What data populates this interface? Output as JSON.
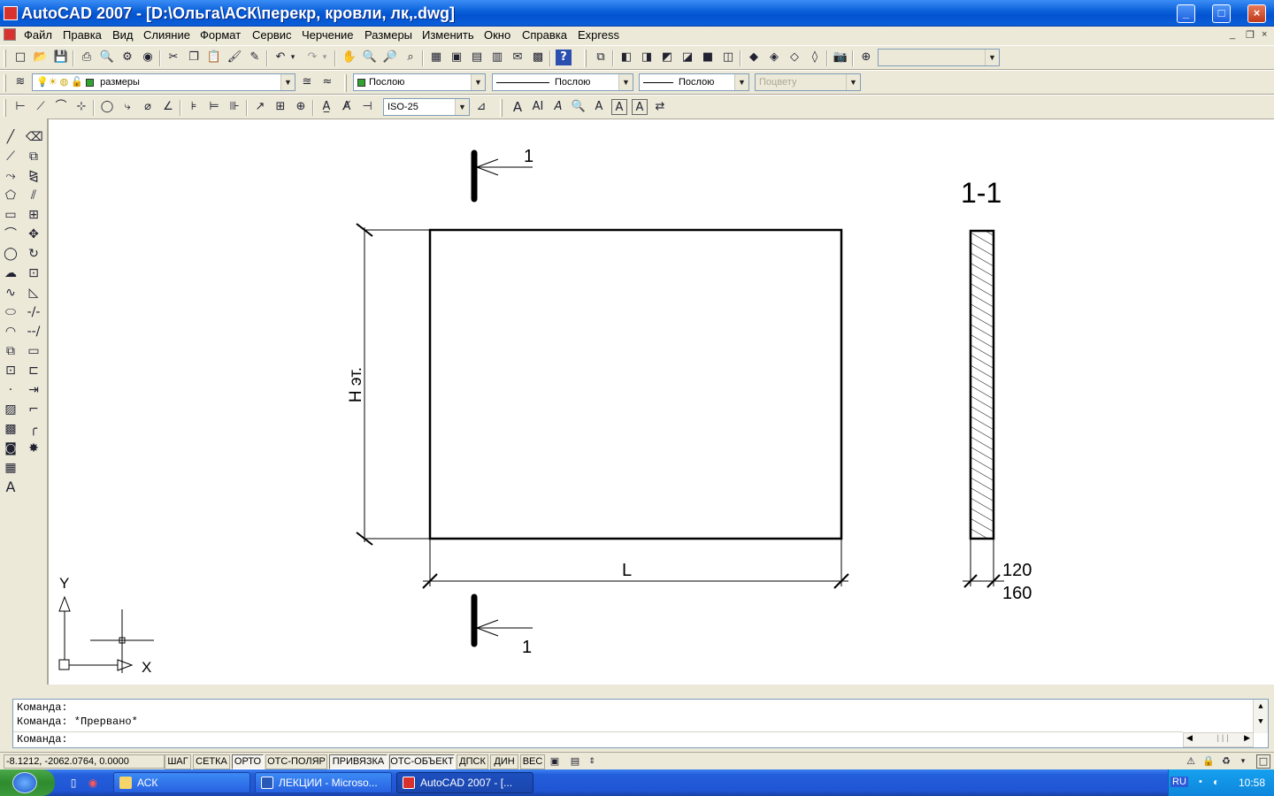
{
  "window": {
    "title": "AutoCAD 2007 - [D:\\Ольга\\АСК\\перекр, кровли, лк,.dwg]"
  },
  "menu": [
    "Файл",
    "Правка",
    "Вид",
    "Слияние",
    "Формат",
    "Сервис",
    "Черчение",
    "Размеры",
    "Изменить",
    "Окно",
    "Справка",
    "Express"
  ],
  "layers": {
    "current": "размеры"
  },
  "properties": {
    "color": "Послою",
    "linetype": "Послою",
    "lineweight": "Послою",
    "plotstyle": "Поцвету"
  },
  "dimstyle": {
    "current": "ISO-25"
  },
  "drawing": {
    "section_mark_top": "1",
    "section_mark_bottom": "1",
    "height_label": "H эт.",
    "length_label": "L",
    "section_title": "1-1",
    "dim_120": "120",
    "dim_160": "160",
    "ucs_x": "X",
    "ucs_y": "Y"
  },
  "command": {
    "line1": "Команда:",
    "line2": "Команда:  *Прервано*",
    "prompt": "Команда:"
  },
  "status": {
    "coords": "-8.1212, -2062.0764, 0.0000",
    "buttons": [
      "ШАГ",
      "СЕТКА",
      "ОРТО",
      "ОТС-ПОЛЯР",
      "ПРИВЯЗКА",
      "ОТС-ОБЪЕКТ",
      "ДПСК",
      "ДИН",
      "ВЕС"
    ]
  },
  "taskbar": {
    "items": [
      "АСК",
      "ЛЕКЦИИ - Microso...",
      "AutoCAD 2007 - [..."
    ],
    "lang": "RU",
    "time": "10:58"
  }
}
